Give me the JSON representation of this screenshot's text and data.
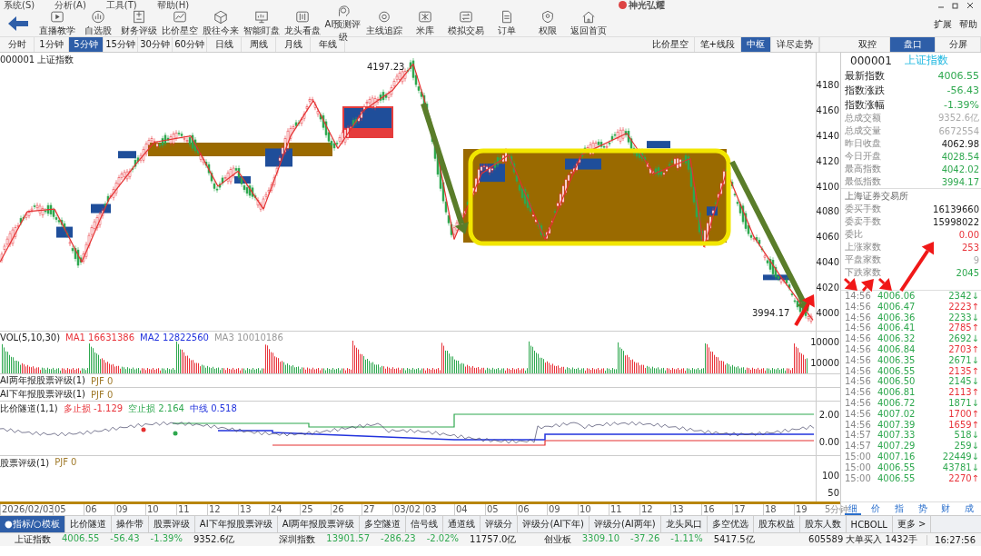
{
  "menu": [
    "系统(S)",
    "分析(A)",
    "工具(T)",
    "帮助(H)"
  ],
  "app_title": "神光弘耀",
  "toolbar": [
    "直播教学",
    "自选股",
    "财务评级",
    "比价星空",
    "股往今来",
    "智能盯盘",
    "龙头看盘",
    "AI预测评级",
    "主线追踪",
    "米库",
    "模拟交易",
    "订单",
    "权限",
    "返回首页"
  ],
  "toolbar_right": [
    "扩展",
    "帮助"
  ],
  "period_tabs": [
    {
      "label": "分时",
      "selected": false
    },
    {
      "label": "1分钟",
      "selected": false
    },
    {
      "label": "5分钟",
      "selected": true
    },
    {
      "label": "15分钟",
      "selected": false
    },
    {
      "label": "30分钟",
      "selected": false
    },
    {
      "label": "60分钟",
      "selected": false
    },
    {
      "label": "日线",
      "selected": false
    },
    {
      "label": "周线",
      "selected": false
    },
    {
      "label": "月线",
      "selected": false
    },
    {
      "label": "年线",
      "selected": false
    }
  ],
  "view_tabs": [
    {
      "label": "比价星空",
      "selected": false
    },
    {
      "label": "笔+线段",
      "selected": false
    },
    {
      "label": "中枢",
      "selected": true
    },
    {
      "label": "详尽走势",
      "selected": false
    }
  ],
  "panel_tabs": [
    {
      "label": "双控",
      "selected": false
    },
    {
      "label": "盘口",
      "selected": true
    },
    {
      "label": "分屏",
      "selected": false
    }
  ],
  "chart": {
    "title": "000001 上证指数",
    "high_label": "4197.23",
    "low_label": "3994.17",
    "y_axis": [
      "4180",
      "4160",
      "4140",
      "4120",
      "4100",
      "4080",
      "4060",
      "4040",
      "4020",
      "4000"
    ]
  },
  "volume": {
    "legend": [
      {
        "text": "VOL(5,10,30)",
        "color": "#222222"
      },
      {
        "text": "MA1 16631386",
        "color": "#e8333a"
      },
      {
        "text": "MA2 12822560",
        "color": "#2233dd"
      },
      {
        "text": "MA3 10010186",
        "color": "#999999"
      }
    ],
    "y_axis": [
      "10000",
      "10000"
    ]
  },
  "rating_rows": [
    {
      "name": "AI两年报股票评级(1)",
      "value": "PJF 0"
    },
    {
      "name": "AI下年报股票评级(1)",
      "value": "PJF 0"
    }
  ],
  "tunnel": {
    "legend": [
      {
        "text": "比价隧道(1,1)",
        "color": "#222222"
      },
      {
        "text": "多止损 -1.129",
        "color": "#e8333a"
      },
      {
        "text": "空止损 2.164",
        "color": "#2fa84f"
      },
      {
        "text": "中线 0.518",
        "color": "#2233dd"
      }
    ],
    "y_axis": [
      "2.00",
      "0.00"
    ]
  },
  "rating": {
    "name": "股票评级(1)",
    "value": "PJF 0",
    "y_axis": [
      "100",
      "50"
    ]
  },
  "dates": [
    "2026/02/03",
    "05",
    "06",
    "09",
    "10",
    "11",
    "12",
    "13",
    "24",
    "25",
    "26",
    "27",
    "03/02",
    "03",
    "04",
    "05",
    "06",
    "09",
    "10",
    "11",
    "12",
    "13",
    "16",
    "17",
    "18",
    "19"
  ],
  "date_unit": "5分钟",
  "quote": {
    "code": "000001",
    "name": "上证指数",
    "stats": [
      {
        "label": "最新指数",
        "value": "4006.55",
        "kind": "major",
        "color": "#2fa84f"
      },
      {
        "label": "指数涨跌",
        "value": "-56.43",
        "kind": "major",
        "color": "#2fa84f"
      },
      {
        "label": "指数涨幅",
        "value": "-1.39%",
        "kind": "major",
        "color": "#2fa84f"
      },
      {
        "label": "总成交额",
        "value": "9352.6亿",
        "kind": "minor",
        "color": "#aaaaaa"
      },
      {
        "label": "总成交量",
        "value": "6672554",
        "kind": "minor",
        "color": "#aaaaaa"
      },
      {
        "label": "昨日收盘",
        "value": "4062.98",
        "kind": "minor",
        "color": "#222222"
      },
      {
        "label": "今日开盘",
        "value": "4028.54",
        "kind": "minor",
        "color": "#2fa84f"
      },
      {
        "label": "最高指数",
        "value": "4042.02",
        "kind": "minor",
        "color": "#2fa84f"
      },
      {
        "label": "最低指数",
        "value": "3994.17",
        "kind": "minor",
        "color": "#2fa84f"
      }
    ],
    "exchange": "上海证券交易所",
    "exchange_stats": [
      {
        "label": "委买手数",
        "value": "16139660",
        "color": "#222222"
      },
      {
        "label": "委卖手数",
        "value": "15998022",
        "color": "#222222"
      },
      {
        "label": "委比",
        "value": "0.00",
        "color": "#e8333a"
      },
      {
        "label": "上涨家数",
        "value": "253",
        "color": "#e8333a"
      },
      {
        "label": "平盘家数",
        "value": "9",
        "color": "#aaaaaa"
      },
      {
        "label": "下跌家数",
        "value": "2045",
        "color": "#2fa84f"
      }
    ],
    "ticks": [
      {
        "time": "14:56",
        "price": "4006.06",
        "volume": "2342↓",
        "color": "#2fa84f"
      },
      {
        "time": "14:56",
        "price": "4006.47",
        "volume": "2223↑",
        "color": "#e8333a"
      },
      {
        "time": "14:56",
        "price": "4006.36",
        "volume": "2233↓",
        "color": "#2fa84f"
      },
      {
        "time": "14:56",
        "price": "4006.41",
        "volume": "2785↑",
        "color": "#e8333a"
      },
      {
        "time": "14:56",
        "price": "4006.32",
        "volume": "2692↓",
        "color": "#2fa84f"
      },
      {
        "time": "14:56",
        "price": "4006.84",
        "volume": "2703↑",
        "color": "#e8333a"
      },
      {
        "time": "14:56",
        "price": "4006.35",
        "volume": "2671↓",
        "color": "#2fa84f"
      },
      {
        "time": "14:56",
        "price": "4006.55",
        "volume": "2135↑",
        "color": "#e8333a"
      },
      {
        "time": "14:56",
        "price": "4006.50",
        "volume": "2145↓",
        "color": "#2fa84f"
      },
      {
        "time": "14:56",
        "price": "4006.81",
        "volume": "2113↑",
        "color": "#e8333a"
      },
      {
        "time": "14:56",
        "price": "4006.72",
        "volume": "1871↓",
        "color": "#2fa84f"
      },
      {
        "time": "14:56",
        "price": "4007.02",
        "volume": "1700↑",
        "color": "#e8333a"
      },
      {
        "time": "14:56",
        "price": "4007.39",
        "volume": "1659↑",
        "color": "#e8333a"
      },
      {
        "time": "14:57",
        "price": "4007.33",
        "volume": "518↓",
        "color": "#2fa84f"
      },
      {
        "time": "14:57",
        "price": "4007.29",
        "volume": "259↓",
        "color": "#2fa84f"
      },
      {
        "time": "15:00",
        "price": "4007.16",
        "volume": "22449↓",
        "color": "#2fa84f"
      },
      {
        "time": "15:00",
        "price": "4006.55",
        "volume": "43781↓",
        "color": "#2fa84f"
      },
      {
        "time": "15:00",
        "price": "4006.55",
        "volume": "2270↑",
        "color": "#e8333a"
      }
    ],
    "tabs": [
      {
        "label": "细",
        "selected": true
      },
      {
        "label": "价",
        "selected": false
      },
      {
        "label": "指",
        "selected": false
      },
      {
        "label": "势",
        "selected": false
      },
      {
        "label": "财",
        "selected": false
      },
      {
        "label": "成",
        "selected": false
      }
    ]
  },
  "bottom_tabs": [
    {
      "label": "●指标/○模板",
      "selected": true
    },
    {
      "label": "比价隧道",
      "selected": false
    },
    {
      "label": "操作带",
      "selected": false
    },
    {
      "label": "股票评级",
      "selected": false
    },
    {
      "label": "AI下年报股票评级",
      "selected": false
    },
    {
      "label": "AI两年报股票评级",
      "selected": false
    },
    {
      "label": "多空隧道",
      "selected": false
    },
    {
      "label": "信号线",
      "selected": false
    },
    {
      "label": "通道线",
      "selected": false
    },
    {
      "label": "评级分",
      "selected": false
    },
    {
      "label": "评级分(AI下年)",
      "selected": false
    },
    {
      "label": "评级分(AI两年)",
      "selected": false
    },
    {
      "label": "龙头风口",
      "selected": false
    },
    {
      "label": "多空优选",
      "selected": false
    },
    {
      "label": "股东权益",
      "selected": false
    },
    {
      "label": "股东人数",
      "selected": false
    },
    {
      "label": "HCBOLL",
      "selected": false
    },
    {
      "label": "更多 >",
      "selected": false
    }
  ],
  "status_bar": {
    "indices": [
      {
        "name": "上证指数",
        "price": "4006.55",
        "change": "-56.43",
        "pct": "-1.39%",
        "amount": "9352.6亿"
      },
      {
        "name": "深圳指数",
        "price": "13901.57",
        "change": "-286.23",
        "pct": "-2.02%",
        "amount": "11757.0亿"
      },
      {
        "name": "创业板",
        "price": "3309.10",
        "change": "-37.26",
        "pct": "-1.11%",
        "amount": "5417.5亿"
      }
    ],
    "alert": "605589 大单买入 1432手",
    "time": "16:27:56"
  }
}
